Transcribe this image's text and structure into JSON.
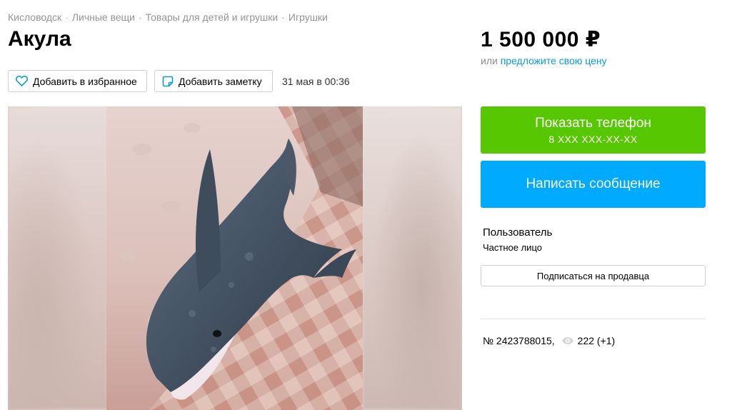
{
  "breadcrumb": {
    "items": [
      "Кисловодск",
      "Личные вещи",
      "Товары для детей и игрушки",
      "Игрушки"
    ],
    "separator": "·"
  },
  "listing": {
    "title": "Акула",
    "date": "31 мая в 00:36",
    "number": "№ 2423788015,",
    "views": "222 (+1)"
  },
  "actions": {
    "favorite_label": "Добавить в избранное",
    "note_label": "Добавить заметку"
  },
  "price": {
    "value": "1 500 000 ₽",
    "offer_prefix": "или",
    "offer_link": "предложите свою цену"
  },
  "contact": {
    "show_phone_label": "Показать телефон",
    "phone_masked": "8 XXX XXX-XX-XX",
    "message_label": "Написать сообщение"
  },
  "seller": {
    "name": "Пользователь",
    "type": "Частное лицо",
    "subscribe_label": "Подписаться на продавца"
  },
  "colors": {
    "green_button": "#56c700",
    "blue_button": "#00aaff",
    "link": "#0a9cd9",
    "breadcrumb_text": "#959595"
  },
  "icons": {
    "favorite": "heart-icon",
    "note": "note-icon",
    "views": "eye-icon"
  }
}
